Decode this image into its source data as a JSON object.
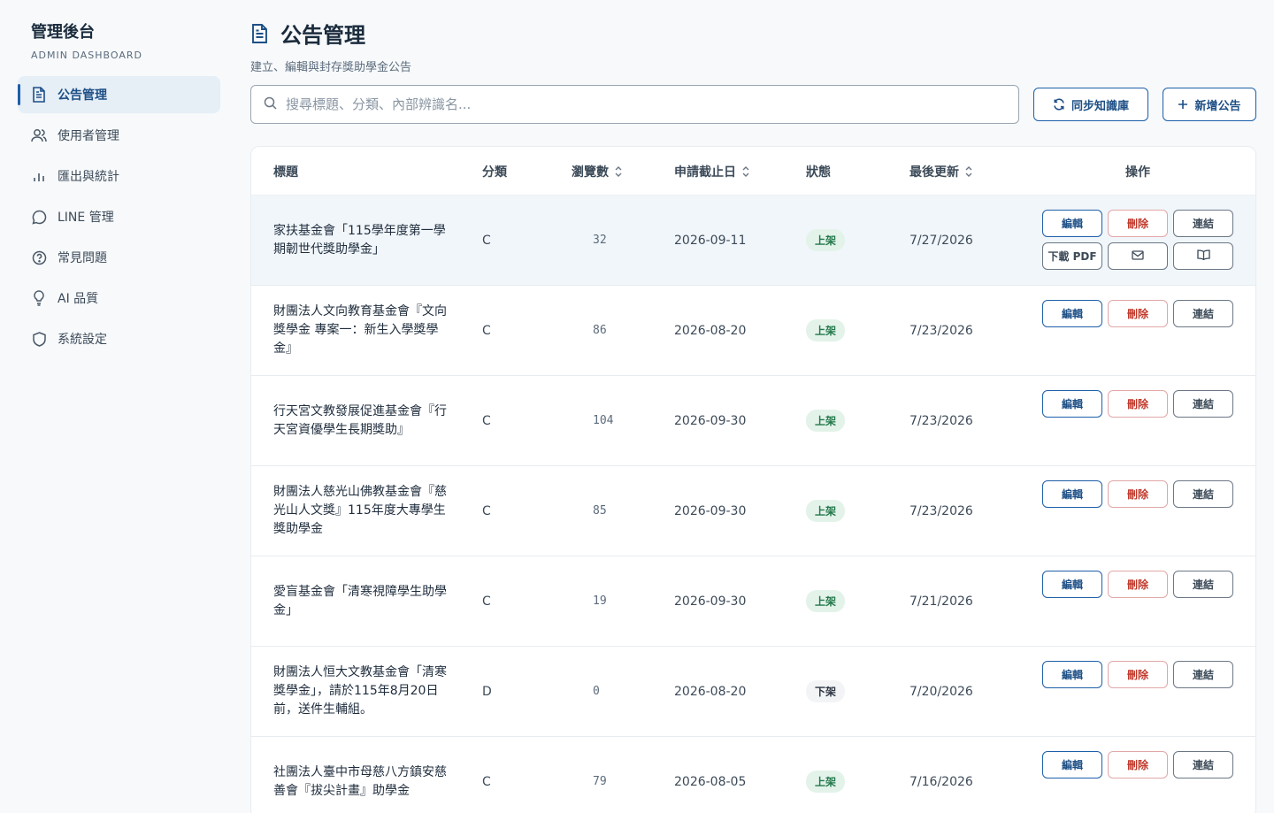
{
  "sidebar": {
    "title": "管理後台",
    "subtitle": "ADMIN DASHBOARD",
    "items": [
      {
        "label": "公告管理",
        "icon": "document-icon",
        "active": true
      },
      {
        "label": "使用者管理",
        "icon": "users-icon"
      },
      {
        "label": "匯出與統計",
        "icon": "bar-chart-icon"
      },
      {
        "label": "LINE 管理",
        "icon": "chat-bubble-icon"
      },
      {
        "label": "常見問題",
        "icon": "help-circle-icon"
      },
      {
        "label": "AI 品質",
        "icon": "lightbulb-icon"
      },
      {
        "label": "系統設定",
        "icon": "shield-icon"
      }
    ]
  },
  "header": {
    "title": "公告管理",
    "subtitle": "建立、編輯與封存獎助學金公告"
  },
  "search": {
    "placeholder": "搜尋標題、分類、內部辨識名...",
    "value": ""
  },
  "toolbar": {
    "sync_label": "同步知識庫",
    "new_label": "新增公告"
  },
  "table": {
    "headers": {
      "title": "標題",
      "category": "分類",
      "views": "瀏覽數",
      "deadline": "申請截止日",
      "status": "狀態",
      "updated": "最後更新",
      "actions": "操作"
    },
    "action_labels": {
      "edit": "編輯",
      "delete": "刪除",
      "link": "連結",
      "pdf": "下載 PDF"
    },
    "rows": [
      {
        "title": "家扶基金會「115學年度第一學期韌世代獎助學金」",
        "category": "C",
        "views": "32",
        "deadline": "2026-09-11",
        "status": "上架",
        "updated": "7/27/2026",
        "extended": true
      },
      {
        "title": "財團法人文向教育基金會『文向獎學金 專案一：新生入學獎學金』",
        "category": "C",
        "views": "86",
        "deadline": "2026-08-20",
        "status": "上架",
        "updated": "7/23/2026"
      },
      {
        "title": "行天宮文教發展促進基金會『行天宮資優學生長期獎助』",
        "category": "C",
        "views": "104",
        "deadline": "2026-09-30",
        "status": "上架",
        "updated": "7/23/2026"
      },
      {
        "title": "財團法人慈光山佛教基金會『慈光山人文獎』115年度大專學生獎助學金",
        "category": "C",
        "views": "85",
        "deadline": "2026-09-30",
        "status": "上架",
        "updated": "7/23/2026"
      },
      {
        "title": "愛盲基金會「清寒視障學生助學金」",
        "category": "C",
        "views": "19",
        "deadline": "2026-09-30",
        "status": "上架",
        "updated": "7/21/2026"
      },
      {
        "title": "財團法人恒大文教基金會「清寒獎學金」，請於115年8月20日前，送件生輔組。",
        "category": "D",
        "views": "0",
        "deadline": "2026-08-20",
        "status": "下架",
        "updated": "7/20/2026"
      },
      {
        "title": "社團法人臺中市母慈八方鎮安慈善會『拔尖計畫』助學金",
        "category": "C",
        "views": "79",
        "deadline": "2026-08-05",
        "status": "上架",
        "updated": "7/16/2026"
      }
    ]
  }
}
